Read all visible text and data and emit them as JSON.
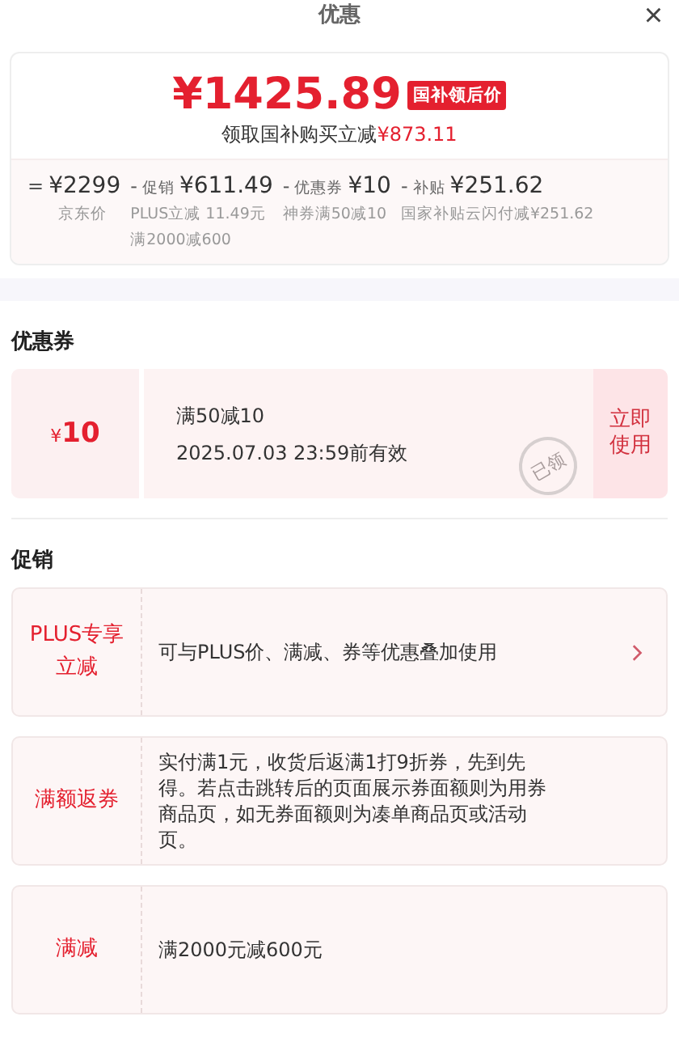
{
  "header": {
    "title": "优惠",
    "close": "×"
  },
  "summary": {
    "price": "¥1425.89",
    "price_tag": "国补领后价",
    "subtitle": "领取国补购买立减",
    "saving": "¥873.11",
    "parts": [
      {
        "op": "=",
        "amount": "¥2299",
        "notes": [
          "京东价"
        ]
      },
      {
        "op": "-",
        "label": "促销",
        "amount": "¥611.49",
        "notes": [
          "PLUS立减 11.49元",
          "满2000减600"
        ]
      },
      {
        "op": "-",
        "label": "优惠券",
        "amount": "¥10",
        "notes": [
          "神券满50减10"
        ]
      },
      {
        "op": "-",
        "label": "补贴",
        "amount": "¥251.62",
        "notes": [
          "国家补贴云闪付减¥251.62"
        ]
      }
    ]
  },
  "coupons": {
    "heading": "优惠券",
    "items": [
      {
        "currency": "¥",
        "value": "10",
        "condition": "满50减10",
        "validity": "2025.07.03 23:59前有效",
        "stamp": "已领",
        "action": "立即使用"
      }
    ]
  },
  "promotions": {
    "heading": "促销",
    "items": [
      {
        "label": "PLUS专享立减",
        "text": "可与PLUS价、满减、券等优惠叠加使用",
        "has_arrow": true
      },
      {
        "label": "满额返券",
        "text": "实付满1元，收货后返满1打9折券，先到先得。若点击跳转后的页面展示券面额则为用券商品页，如无券面额则为凑单商品页或活动页。",
        "has_arrow": false
      },
      {
        "label": "满减",
        "text": "满2000元减600元",
        "has_arrow": false
      }
    ]
  }
}
